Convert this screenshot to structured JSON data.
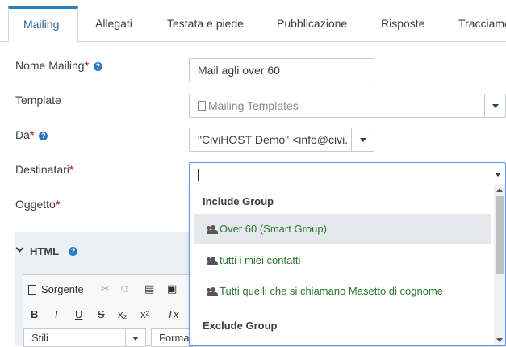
{
  "tabs": [
    {
      "label": "Mailing",
      "active": true
    },
    {
      "label": "Allegati"
    },
    {
      "label": "Testata e piede"
    },
    {
      "label": "Pubblicazione"
    },
    {
      "label": "Risposte"
    },
    {
      "label": "Tracciame"
    }
  ],
  "form": {
    "name_label": "Nome Mailing",
    "name_value": "Mail agli over 60",
    "template_label": "Template",
    "template_placeholder": "Mailing Templates",
    "from_label": "Da",
    "from_value": "\"CiviHOST Demo\" <info@civi...",
    "recipients_label": "Destinatari",
    "subject_label": "Oggetto",
    "required_mark": "*",
    "help_glyph": "?"
  },
  "html_panel": {
    "title": "HTML",
    "toolbar": {
      "source": "Sorgente",
      "bold": "B",
      "italic": "I",
      "underline": "U",
      "strike": "S",
      "sub": "x₂",
      "sup": "x²",
      "clear": "Tx",
      "styles": "Stili",
      "format": "Forma"
    }
  },
  "dropdown": {
    "include_group": "Include Group",
    "exclude_group": "Exclude Group",
    "options": [
      {
        "label": "Over 60 (Smart Group)",
        "highlighted": true
      },
      {
        "label": "tutti i miei contatti"
      },
      {
        "label": "Tutti quelli che si chiamano Masetto di cognome"
      }
    ]
  },
  "colors": {
    "accent": "#2a7ec0",
    "required": "#cf3458",
    "option_text": "#2a7a2a",
    "focus_border": "#5897fb"
  }
}
